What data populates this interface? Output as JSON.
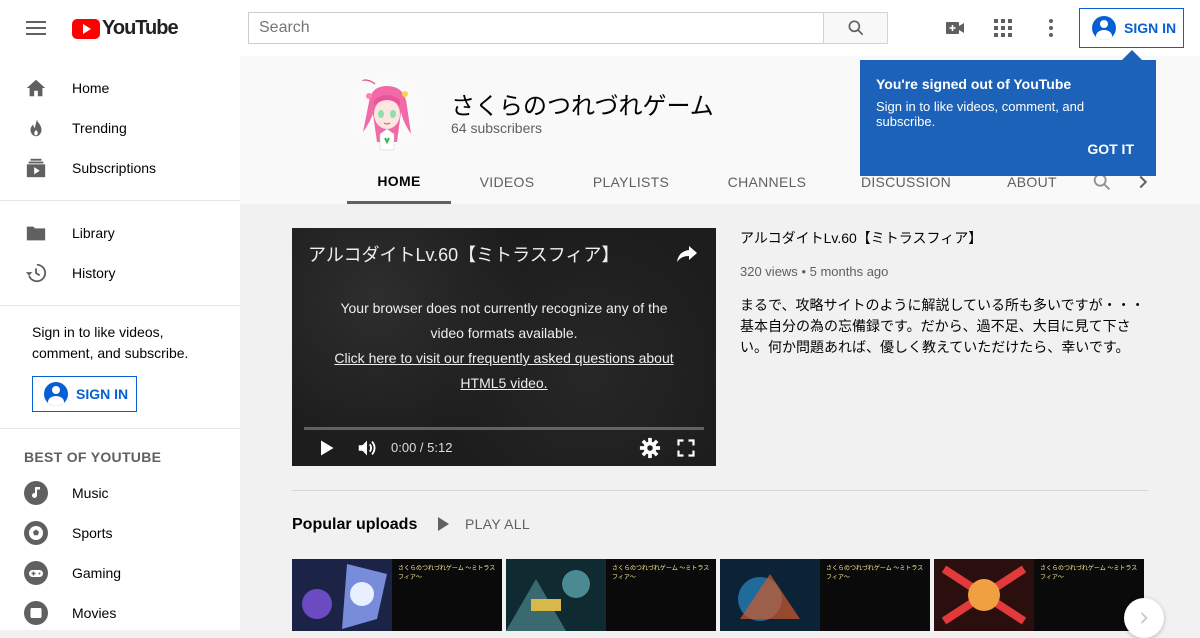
{
  "topbar": {
    "logo_text": "YouTube",
    "search_placeholder": "Search",
    "signin_label": "SIGN IN"
  },
  "sidebar": {
    "primary": [
      {
        "label": "Home",
        "icon": "home-icon"
      },
      {
        "label": "Trending",
        "icon": "flame-icon"
      },
      {
        "label": "Subscriptions",
        "icon": "subscriptions-icon"
      }
    ],
    "secondary": [
      {
        "label": "Library",
        "icon": "folder-icon"
      },
      {
        "label": "History",
        "icon": "history-icon"
      }
    ],
    "signin_prompt": "Sign in to like videos, comment, and subscribe.",
    "signin_label": "SIGN IN",
    "best_heading": "BEST OF YOUTUBE",
    "best": [
      {
        "label": "Music",
        "icon": "music-icon"
      },
      {
        "label": "Sports",
        "icon": "sports-icon"
      },
      {
        "label": "Gaming",
        "icon": "gaming-icon"
      },
      {
        "label": "Movies",
        "icon": "movies-icon"
      }
    ]
  },
  "channel": {
    "name": "さくらのつれづれゲーム",
    "subscribers": "64 subscribers",
    "tabs": [
      "HOME",
      "VIDEOS",
      "PLAYLISTS",
      "CHANNELS",
      "DISCUSSION",
      "ABOUT"
    ],
    "active_tab": "HOME"
  },
  "popup": {
    "title": "You're signed out of YouTube",
    "body": "Sign in to like videos, comment, and subscribe.",
    "button": "GOT IT"
  },
  "player": {
    "title": "アルコダイトLv.60【ミトラスフィア】",
    "message": "Your browser does not currently recognize any of the video formats available.",
    "link": "Click here to visit our frequently asked questions about HTML5 video.",
    "time": "0:00 / 5:12",
    "progress": 0
  },
  "video": {
    "title": "アルコダイトLv.60【ミトラスフィア】",
    "views": "320 views",
    "age": "5 months ago",
    "description": "まるで、攻略サイトのように解説している所も多いですが・・・基本自分の為の忘備録です。だから、過不足、大目に見て下さい。何か問題あれば、優しく教えていただけたら、幸いです。"
  },
  "popular": {
    "title": "Popular uploads",
    "play_all": "PLAY ALL"
  },
  "colors": {
    "brand_red": "#ff0000",
    "accent_blue": "#065fd4",
    "popup_blue": "#1c62b9"
  }
}
